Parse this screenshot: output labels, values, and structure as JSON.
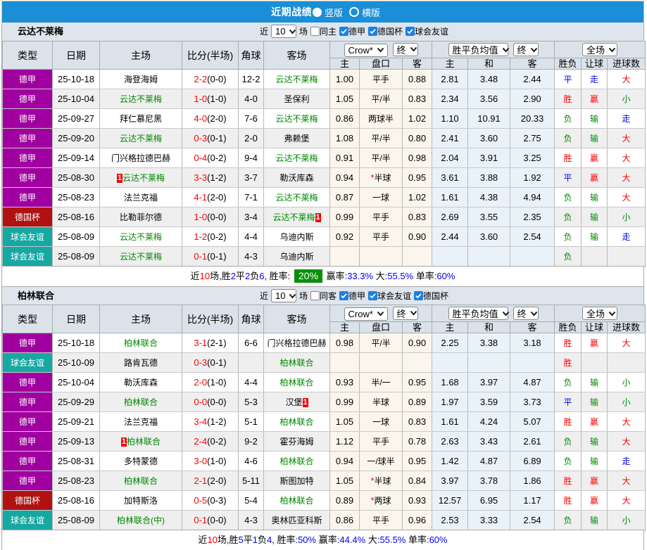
{
  "banner": {
    "title": "近期战绩",
    "options": [
      {
        "label": "竖版",
        "selected": true
      },
      {
        "label": "横版",
        "selected": false
      }
    ]
  },
  "colors": {
    "banner_blue": "#1a8ed6",
    "league_purple": "#a000a0",
    "cup_red": "#b01212",
    "friendly_teal": "#16a8a2",
    "win_red": "#ff0000",
    "lose_green": "#008800",
    "draw_blue": "#0000f0",
    "badge_green": "#089008"
  },
  "table_header": {
    "cols": [
      "类型",
      "日期",
      "主场",
      "比分(半场)",
      "角球",
      "客场"
    ],
    "select_odds": "Crow*",
    "select_odds_state": "终",
    "select_avg": "胜平负均值",
    "select_avg_state": "终",
    "select_scope": "全场",
    "subcols": [
      "主",
      "盘口",
      "客",
      "主",
      "和",
      "客",
      "胜负",
      "让球",
      "进球数"
    ]
  },
  "teams": [
    {
      "name": "云达不莱梅",
      "filters": {
        "prefix": "近",
        "count": "10",
        "suffix": "场",
        "same": "同主",
        "leagues": [
          "德甲",
          "德国杯",
          "球会友谊"
        ]
      },
      "rows": [
        {
          "type": "德甲",
          "k": "league",
          "date": "25-10-18",
          "home": {
            "t": "海登海姆"
          },
          "ft": "2-2",
          "ht": "(0-0)",
          "corner": "12-2",
          "away": {
            "t": "云达不莱梅",
            "focal": true
          },
          "o1": "1.00",
          "hstar": "",
          "hc": "平手",
          "o2": "0.88",
          "a1": "2.81",
          "a2": "3.48",
          "a3": "2.44",
          "r1": {
            "t": "平",
            "c": "b"
          },
          "r2": {
            "t": "走",
            "c": "b"
          },
          "r3": {
            "t": "大",
            "c": "r"
          }
        },
        {
          "type": "德甲",
          "k": "league",
          "date": "25-10-04",
          "home": {
            "t": "云达不莱梅",
            "focal": true
          },
          "ft": "1-0",
          "ht": "(1-0)",
          "corner": "4-0",
          "away": {
            "t": "圣保利"
          },
          "o1": "1.05",
          "hstar": "",
          "hc": "平/半",
          "o2": "0.83",
          "a1": "2.34",
          "a2": "3.56",
          "a3": "2.90",
          "r1": {
            "t": "胜",
            "c": "r"
          },
          "r2": {
            "t": "赢",
            "c": "r"
          },
          "r3": {
            "t": "小",
            "c": "g"
          }
        },
        {
          "type": "德甲",
          "k": "league",
          "date": "25-09-27",
          "home": {
            "t": "拜仁慕尼黑"
          },
          "ft": "4-0",
          "ht": "(2-0)",
          "corner": "7-6",
          "away": {
            "t": "云达不莱梅",
            "focal": true
          },
          "o1": "0.86",
          "hstar": "",
          "hc": "两球半",
          "o2": "1.02",
          "a1": "1.10",
          "a2": "10.91",
          "a3": "20.33",
          "r1": {
            "t": "负",
            "c": "g"
          },
          "r2": {
            "t": "输",
            "c": "g"
          },
          "r3": {
            "t": "走",
            "c": "b"
          }
        },
        {
          "type": "德甲",
          "k": "league",
          "date": "25-09-20",
          "home": {
            "t": "云达不莱梅",
            "focal": true
          },
          "ft": "0-3",
          "ht": "(0-1)",
          "corner": "2-0",
          "away": {
            "t": "弗赖堡"
          },
          "o1": "1.08",
          "hstar": "",
          "hc": "平/半",
          "o2": "0.80",
          "a1": "2.41",
          "a2": "3.60",
          "a3": "2.75",
          "r1": {
            "t": "负",
            "c": "g"
          },
          "r2": {
            "t": "输",
            "c": "g"
          },
          "r3": {
            "t": "大",
            "c": "r"
          }
        },
        {
          "type": "德甲",
          "k": "league",
          "date": "25-09-14",
          "home": {
            "t": "门兴格拉德巴赫"
          },
          "ft": "0-4",
          "ht": "(0-2)",
          "corner": "9-4",
          "away": {
            "t": "云达不莱梅",
            "focal": true
          },
          "o1": "0.91",
          "hstar": "",
          "hc": "平/半",
          "o2": "0.98",
          "a1": "2.04",
          "a2": "3.91",
          "a3": "3.25",
          "r1": {
            "t": "胜",
            "c": "r"
          },
          "r2": {
            "t": "赢",
            "c": "r"
          },
          "r3": {
            "t": "大",
            "c": "r"
          }
        },
        {
          "type": "德甲",
          "k": "league",
          "date": "25-08-30",
          "home": {
            "t": "云达不莱梅",
            "focal": true,
            "card_pre": "1"
          },
          "ft": "3-3",
          "ht": "(1-2)",
          "corner": "3-7",
          "away": {
            "t": "勒沃库森"
          },
          "o1": "0.94",
          "hstar": "*",
          "hc": "半球",
          "o2": "0.95",
          "a1": "3.61",
          "a2": "3.88",
          "a3": "1.92",
          "r1": {
            "t": "平",
            "c": "b"
          },
          "r2": {
            "t": "赢",
            "c": "r"
          },
          "r3": {
            "t": "大",
            "c": "r"
          }
        },
        {
          "type": "德甲",
          "k": "league",
          "date": "25-08-23",
          "home": {
            "t": "法兰克福"
          },
          "ft": "4-1",
          "ht": "(2-0)",
          "corner": "7-1",
          "away": {
            "t": "云达不莱梅",
            "focal": true
          },
          "o1": "0.87",
          "hstar": "",
          "hc": "一球",
          "o2": "1.02",
          "a1": "1.61",
          "a2": "4.38",
          "a3": "4.94",
          "r1": {
            "t": "负",
            "c": "g"
          },
          "r2": {
            "t": "输",
            "c": "g"
          },
          "r3": {
            "t": "大",
            "c": "r"
          }
        },
        {
          "type": "德国杯",
          "k": "cup",
          "date": "25-08-16",
          "home": {
            "t": "比勒菲尔德"
          },
          "ft": "1-0",
          "ht": "(0-0)",
          "corner": "3-4",
          "away": {
            "t": "云达不莱梅",
            "focal": true,
            "card_post": "1"
          },
          "o1": "0.99",
          "hstar": "",
          "hc": "平手",
          "o2": "0.83",
          "a1": "2.69",
          "a2": "3.55",
          "a3": "2.35",
          "r1": {
            "t": "负",
            "c": "g"
          },
          "r2": {
            "t": "输",
            "c": "g"
          },
          "r3": {
            "t": "小",
            "c": "g"
          }
        },
        {
          "type": "球会友谊",
          "k": "friendly",
          "date": "25-08-09",
          "home": {
            "t": "云达不莱梅",
            "focal": true
          },
          "ft": "1-2",
          "ht": "(0-2)",
          "corner": "4-4",
          "away": {
            "t": "乌迪内斯"
          },
          "o1": "0.92",
          "hstar": "",
          "hc": "平手",
          "o2": "0.90",
          "a1": "2.44",
          "a2": "3.60",
          "a3": "2.54",
          "r1": {
            "t": "负",
            "c": "g"
          },
          "r2": {
            "t": "输",
            "c": "g"
          },
          "r3": {
            "t": "走",
            "c": "b"
          }
        },
        {
          "type": "球会友谊",
          "k": "friendly",
          "date": "25-08-09",
          "home": {
            "t": "云达不莱梅",
            "focal": true
          },
          "ft": "0-1",
          "ht": "(0-1)",
          "corner": "4-3",
          "away": {
            "t": "乌迪内斯"
          },
          "o1": "",
          "hstar": "",
          "hc": "",
          "o2": "",
          "a1": "",
          "a2": "",
          "a3": "",
          "r1": {
            "t": "负",
            "c": "g"
          },
          "r2": {
            "t": "",
            "c": "k"
          },
          "r3": {
            "t": "",
            "c": "k"
          }
        }
      ],
      "summary": [
        {
          "t": "近",
          "c": "k"
        },
        {
          "t": "10",
          "c": "r"
        },
        {
          "t": "场,胜",
          "c": "k"
        },
        {
          "t": "2",
          "c": "b"
        },
        {
          "t": "平",
          "c": "k"
        },
        {
          "t": "2",
          "c": "b"
        },
        {
          "t": "负",
          "c": "k"
        },
        {
          "t": "6",
          "c": "b"
        },
        {
          "t": ", 胜率: ",
          "c": "k"
        },
        {
          "t": "20%",
          "c": "badge"
        },
        {
          "t": " 赢率",
          "c": "k"
        },
        {
          "t": ":33.3%",
          "c": "b"
        },
        {
          "t": " 大",
          "c": "k"
        },
        {
          "t": ":55.5%",
          "c": "b"
        },
        {
          "t": " 单率",
          "c": "k"
        },
        {
          "t": ":60%",
          "c": "b"
        }
      ]
    },
    {
      "name": "柏林联合",
      "filters": {
        "prefix": "近",
        "count": "10",
        "suffix": "场",
        "same": "同客",
        "leagues": [
          "德甲",
          "球会友谊",
          "德国杯"
        ]
      },
      "rows": [
        {
          "type": "德甲",
          "k": "league",
          "date": "25-10-18",
          "home": {
            "t": "柏林联合",
            "focal": true
          },
          "ft": "3-1",
          "ht": "(2-1)",
          "corner": "6-6",
          "away": {
            "t": "门兴格拉德巴赫"
          },
          "o1": "0.98",
          "hstar": "",
          "hc": "平/半",
          "o2": "0.90",
          "a1": "2.25",
          "a2": "3.38",
          "a3": "3.18",
          "r1": {
            "t": "胜",
            "c": "r"
          },
          "r2": {
            "t": "赢",
            "c": "r"
          },
          "r3": {
            "t": "大",
            "c": "r"
          }
        },
        {
          "type": "球会友谊",
          "k": "friendly",
          "date": "25-10-09",
          "home": {
            "t": "路肯瓦德"
          },
          "ft": "0-3",
          "ht": "(0-1)",
          "corner": "",
          "away": {
            "t": "柏林联合",
            "focal": true
          },
          "o1": "",
          "hstar": "",
          "hc": "",
          "o2": "",
          "a1": "",
          "a2": "",
          "a3": "",
          "r1": {
            "t": "胜",
            "c": "r"
          },
          "r2": {
            "t": "",
            "c": "k"
          },
          "r3": {
            "t": "",
            "c": "k"
          }
        },
        {
          "type": "德甲",
          "k": "league",
          "date": "25-10-04",
          "home": {
            "t": "勒沃库森"
          },
          "ft": "2-0",
          "ht": "(1-0)",
          "corner": "4-4",
          "away": {
            "t": "柏林联合",
            "focal": true
          },
          "o1": "0.93",
          "hstar": "",
          "hc": "半/一",
          "o2": "0.95",
          "a1": "1.68",
          "a2": "3.97",
          "a3": "4.87",
          "r1": {
            "t": "负",
            "c": "g"
          },
          "r2": {
            "t": "输",
            "c": "g"
          },
          "r3": {
            "t": "小",
            "c": "g"
          }
        },
        {
          "type": "德甲",
          "k": "league",
          "date": "25-09-29",
          "home": {
            "t": "柏林联合",
            "focal": true
          },
          "ft": "0-0",
          "ht": "(0-0)",
          "corner": "5-3",
          "away": {
            "t": "汉堡",
            "card_post": "1"
          },
          "o1": "0.99",
          "hstar": "",
          "hc": "半球",
          "o2": "0.89",
          "a1": "1.97",
          "a2": "3.59",
          "a3": "3.73",
          "r1": {
            "t": "平",
            "c": "b"
          },
          "r2": {
            "t": "输",
            "c": "g"
          },
          "r3": {
            "t": "小",
            "c": "g"
          }
        },
        {
          "type": "德甲",
          "k": "league",
          "date": "25-09-21",
          "home": {
            "t": "法兰克福"
          },
          "ft": "3-4",
          "ht": "(1-2)",
          "corner": "5-1",
          "away": {
            "t": "柏林联合",
            "focal": true
          },
          "o1": "1.05",
          "hstar": "",
          "hc": "一球",
          "o2": "0.83",
          "a1": "1.61",
          "a2": "4.24",
          "a3": "5.07",
          "r1": {
            "t": "胜",
            "c": "r"
          },
          "r2": {
            "t": "赢",
            "c": "r"
          },
          "r3": {
            "t": "大",
            "c": "r"
          }
        },
        {
          "type": "德甲",
          "k": "league",
          "date": "25-09-13",
          "home": {
            "t": "柏林联合",
            "focal": true,
            "card_pre": "1"
          },
          "ft": "2-4",
          "ht": "(0-2)",
          "corner": "9-2",
          "away": {
            "t": "霍芬海姆"
          },
          "o1": "1.12",
          "hstar": "",
          "hc": "平手",
          "o2": "0.78",
          "a1": "2.63",
          "a2": "3.43",
          "a3": "2.61",
          "r1": {
            "t": "负",
            "c": "g"
          },
          "r2": {
            "t": "输",
            "c": "g"
          },
          "r3": {
            "t": "大",
            "c": "r"
          }
        },
        {
          "type": "德甲",
          "k": "league",
          "date": "25-08-31",
          "home": {
            "t": "多特蒙德"
          },
          "ft": "3-0",
          "ht": "(1-0)",
          "corner": "4-6",
          "away": {
            "t": "柏林联合",
            "focal": true
          },
          "o1": "0.94",
          "hstar": "",
          "hc": "一/球半",
          "o2": "0.95",
          "a1": "1.42",
          "a2": "4.87",
          "a3": "6.89",
          "r1": {
            "t": "负",
            "c": "g"
          },
          "r2": {
            "t": "输",
            "c": "g"
          },
          "r3": {
            "t": "走",
            "c": "b"
          }
        },
        {
          "type": "德甲",
          "k": "league",
          "date": "25-08-23",
          "home": {
            "t": "柏林联合",
            "focal": true
          },
          "ft": "2-1",
          "ht": "(2-0)",
          "corner": "5-11",
          "away": {
            "t": "斯图加特"
          },
          "o1": "1.05",
          "hstar": "*",
          "hc": "半球",
          "o2": "0.84",
          "a1": "3.97",
          "a2": "3.78",
          "a3": "1.86",
          "r1": {
            "t": "胜",
            "c": "r"
          },
          "r2": {
            "t": "赢",
            "c": "r"
          },
          "r3": {
            "t": "大",
            "c": "r"
          }
        },
        {
          "type": "德国杯",
          "k": "cup",
          "date": "25-08-16",
          "home": {
            "t": "加特斯洛"
          },
          "ft": "0-5",
          "ht": "(0-3)",
          "corner": "5-4",
          "away": {
            "t": "柏林联合",
            "focal": true
          },
          "o1": "0.89",
          "hstar": "*",
          "hc": "两球",
          "o2": "0.93",
          "a1": "12.57",
          "a2": "6.95",
          "a3": "1.17",
          "r1": {
            "t": "胜",
            "c": "r"
          },
          "r2": {
            "t": "赢",
            "c": "r"
          },
          "r3": {
            "t": "大",
            "c": "r"
          }
        },
        {
          "type": "球会友谊",
          "k": "friendly",
          "date": "25-08-09",
          "home": {
            "t": "柏林联合(中)",
            "focal": true
          },
          "ft": "0-1",
          "ht": "(0-0)",
          "corner": "4-3",
          "away": {
            "t": "奥林匹亚科斯"
          },
          "o1": "0.86",
          "hstar": "",
          "hc": "平手",
          "o2": "0.96",
          "a1": "2.53",
          "a2": "3.33",
          "a3": "2.54",
          "r1": {
            "t": "负",
            "c": "g"
          },
          "r2": {
            "t": "输",
            "c": "g"
          },
          "r3": {
            "t": "小",
            "c": "g"
          }
        }
      ],
      "summary": [
        {
          "t": "近",
          "c": "k"
        },
        {
          "t": "10",
          "c": "r"
        },
        {
          "t": "场,胜",
          "c": "k"
        },
        {
          "t": "5",
          "c": "b"
        },
        {
          "t": "平",
          "c": "k"
        },
        {
          "t": "1",
          "c": "b"
        },
        {
          "t": "负",
          "c": "k"
        },
        {
          "t": "4",
          "c": "b"
        },
        {
          "t": ", 胜率",
          "c": "k"
        },
        {
          "t": ":50%",
          "c": "b"
        },
        {
          "t": " 赢率",
          "c": "k"
        },
        {
          "t": ":44.4%",
          "c": "b"
        },
        {
          "t": " 大",
          "c": "k"
        },
        {
          "t": ":55.5%",
          "c": "b"
        },
        {
          "t": " 单率",
          "c": "k"
        },
        {
          "t": ":60%",
          "c": "b"
        }
      ]
    }
  ]
}
